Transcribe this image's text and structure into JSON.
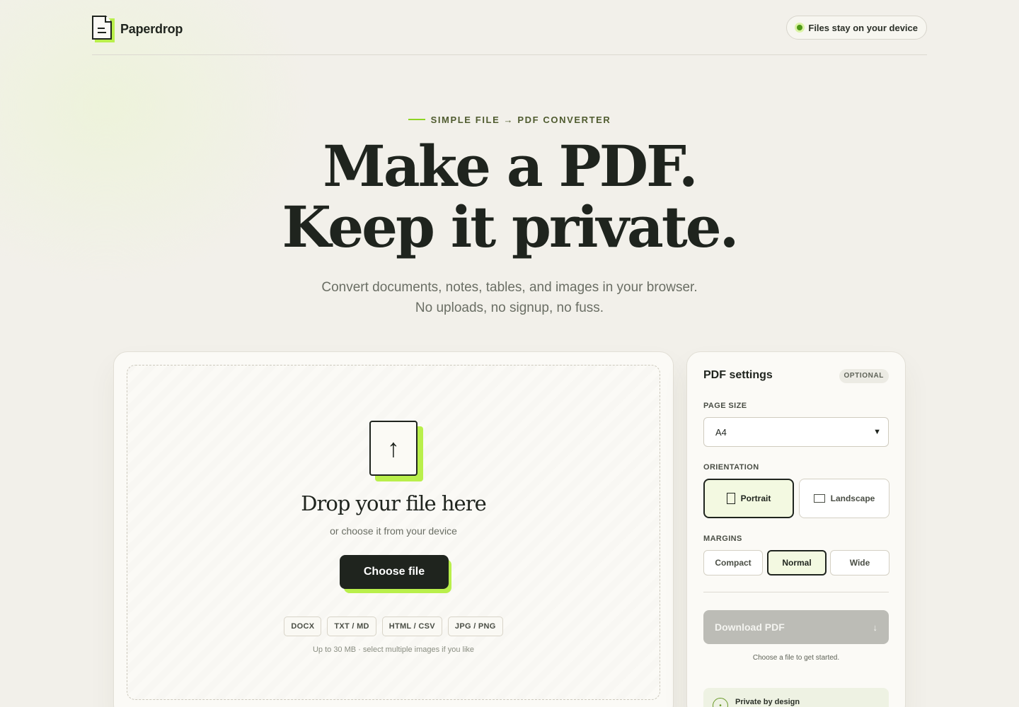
{
  "brand": {
    "name": "Paperdrop",
    "logo_icon": "document-icon"
  },
  "header": {
    "privacy_pill": "Files stay on your device"
  },
  "hero": {
    "eyebrow": "SIMPLE FILE → PDF CONVERTER",
    "headline_line1": "Make a PDF.",
    "headline_line2": "Keep it private.",
    "subhead": "Convert documents, notes, tables, and images in your browser. No uploads, no signup, no fuss."
  },
  "upload": {
    "icon": "upload-arrow-icon",
    "icon_glyph": "↑",
    "title": "Drop your file here",
    "subtitle": "or choose it from your device",
    "choose_button": "Choose file",
    "formats": [
      "DOCX",
      "TXT / MD",
      "HTML / CSV",
      "JPG / PNG"
    ],
    "limit_note": "Up to 30 MB · select multiple images if you like"
  },
  "settings": {
    "title": "PDF settings",
    "badge": "OPTIONAL",
    "page_size_label": "PAGE SIZE",
    "page_size_value": "A4",
    "orientation_label": "ORIENTATION",
    "orientation_options": [
      "Portrait",
      "Landscape"
    ],
    "orientation_selected": "Portrait",
    "margins_label": "MARGINS",
    "margin_options": [
      "Compact",
      "Normal",
      "Wide"
    ],
    "margin_selected": "Normal",
    "download_button": "Download PDF",
    "download_arrow": "↓",
    "download_hint": "Choose a file to get started.",
    "private_title": "Private by design"
  },
  "colors": {
    "accent": "#b9ef4b",
    "ink": "#1f241e",
    "background": "#f2f0ea"
  }
}
